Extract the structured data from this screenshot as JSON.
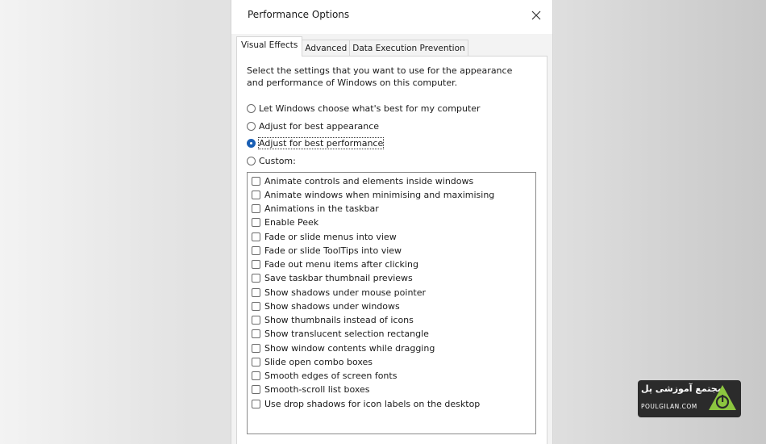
{
  "window": {
    "title": "Performance Options"
  },
  "tabs": [
    {
      "label": "Visual Effects",
      "active": true
    },
    {
      "label": "Advanced",
      "active": false
    },
    {
      "label": "Data Execution Prevention",
      "active": false
    }
  ],
  "visual_effects": {
    "description": "Select the settings that you want to use for the appearance and performance of Windows on this computer.",
    "options": [
      {
        "label": "Let Windows choose what's best for my computer",
        "checked": false
      },
      {
        "label": "Adjust for best appearance",
        "checked": false
      },
      {
        "label": "Adjust for best performance",
        "checked": true
      },
      {
        "label": "Custom:",
        "checked": false
      }
    ],
    "effects": [
      {
        "label": "Animate controls and elements inside windows",
        "checked": false
      },
      {
        "label": "Animate windows when minimising and maximising",
        "checked": false
      },
      {
        "label": "Animations in the taskbar",
        "checked": false
      },
      {
        "label": "Enable Peek",
        "checked": false
      },
      {
        "label": "Fade or slide menus into view",
        "checked": false
      },
      {
        "label": "Fade or slide ToolTips into view",
        "checked": false
      },
      {
        "label": "Fade out menu items after clicking",
        "checked": false
      },
      {
        "label": "Save taskbar thumbnail previews",
        "checked": false
      },
      {
        "label": "Show shadows under mouse pointer",
        "checked": false
      },
      {
        "label": "Show shadows under windows",
        "checked": false
      },
      {
        "label": "Show thumbnails instead of icons",
        "checked": false
      },
      {
        "label": "Show translucent selection rectangle",
        "checked": false
      },
      {
        "label": "Show window contents while dragging",
        "checked": false
      },
      {
        "label": "Slide open combo boxes",
        "checked": false
      },
      {
        "label": "Smooth edges of screen fonts",
        "checked": false
      },
      {
        "label": "Smooth-scroll list boxes",
        "checked": false
      },
      {
        "label": "Use drop shadows for icon labels on the desktop",
        "checked": false
      }
    ]
  },
  "watermark": {
    "title": "مجتمع آموزشی پل",
    "subtitle": "POULGILAN.COM",
    "logo_icon": "power-icon",
    "accent_color": "#8cc63f"
  },
  "colors": {
    "radio_selected": "#1a5fb4"
  }
}
